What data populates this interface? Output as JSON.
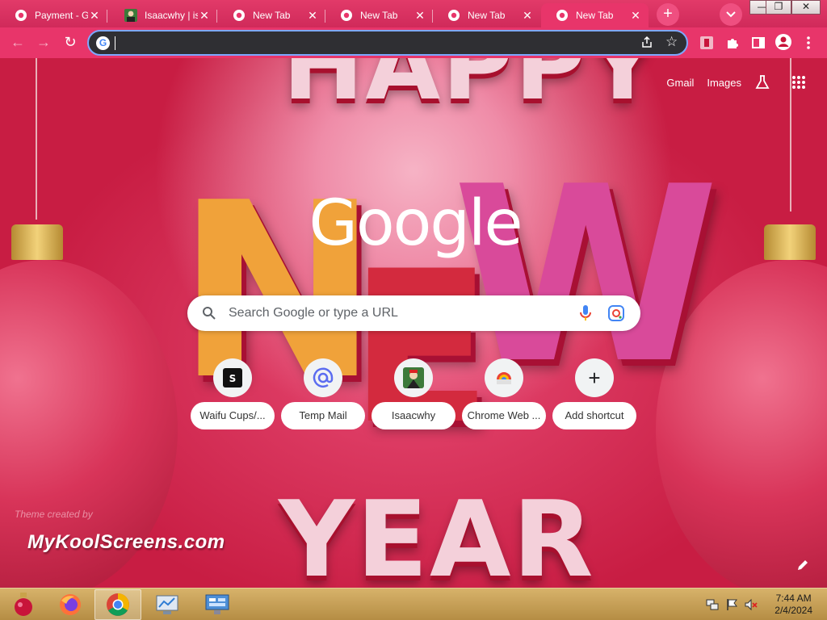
{
  "tabs": [
    {
      "title": "Payment - G",
      "icon": "chrome-icon",
      "active": false
    },
    {
      "title": "Isaacwhy | is",
      "icon": "avatar-icon",
      "active": false
    },
    {
      "title": "New Tab",
      "icon": "chrome-icon",
      "active": false
    },
    {
      "title": "New Tab",
      "icon": "chrome-icon",
      "active": false
    },
    {
      "title": "New Tab",
      "icon": "chrome-icon",
      "active": false
    },
    {
      "title": "New Tab",
      "icon": "chrome-icon",
      "active": true
    }
  ],
  "tabstrip": {
    "new_tab_label": "+",
    "close_glyph": "✕"
  },
  "window_controls": {
    "minimize": "—",
    "restore": "❐",
    "close": "✕"
  },
  "omnibox": {
    "value": "",
    "google_glyph": "G"
  },
  "ntp": {
    "logo": "Google",
    "links": {
      "gmail": "Gmail",
      "images": "Images"
    },
    "search_placeholder": "Search Google or type a URL",
    "shortcuts": [
      {
        "label": "Waifu Cups/...",
        "icon": "waifu-cups-icon"
      },
      {
        "label": "Temp Mail",
        "icon": "at-sign-icon"
      },
      {
        "label": "Isaacwhy",
        "icon": "isaacwhy-avatar-icon"
      },
      {
        "label": "Chrome Web ...",
        "icon": "chrome-web-store-icon"
      },
      {
        "label": "Add shortcut",
        "icon": "plus-icon",
        "glyph": "+"
      }
    ],
    "theme_credit": "Theme created by",
    "watermark": "MyKoolScreens.com",
    "theme_text": {
      "happy": "HAPPY",
      "new": [
        "N",
        "E",
        "W"
      ],
      "year": "YEAR"
    }
  },
  "taskbar": {
    "apps": [
      {
        "name": "ornament-start-icon"
      },
      {
        "name": "firefox-icon"
      },
      {
        "name": "chrome-icon",
        "running": true
      },
      {
        "name": "control-panel-icon"
      },
      {
        "name": "remote-desktop-icon"
      }
    ],
    "time": "7:44 AM",
    "date": "2/4/2024"
  },
  "colors": {
    "accent": "#e8356a",
    "tabstrip": "#d02a5a",
    "omnibox": "#2f2f33",
    "focus_ring": "#7ea8ff"
  }
}
